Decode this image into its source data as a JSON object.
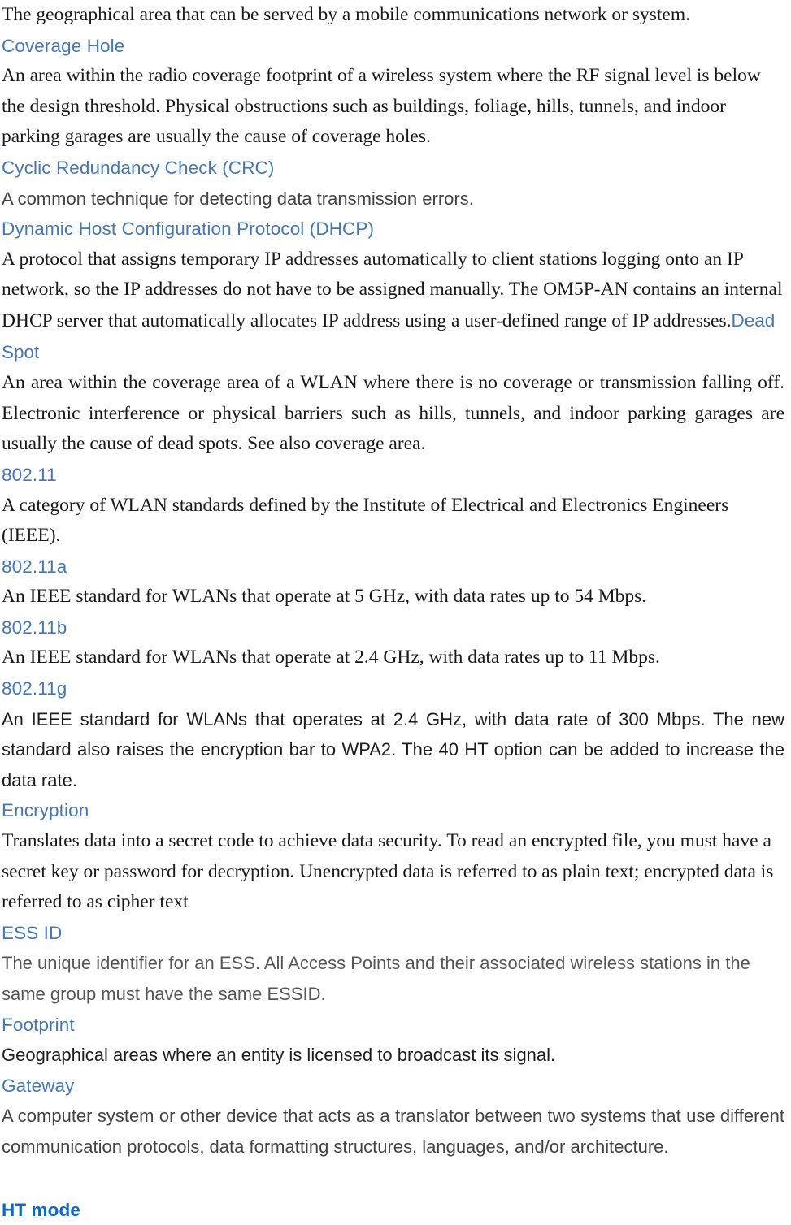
{
  "page": {
    "kind": "glossary-continuation",
    "colors": {
      "term_blue": "#4477b5",
      "term_blue_strong": "#1168c4",
      "body_serif": "#191919",
      "body_sans": "#434343",
      "body_sans_light": "#565656",
      "background": "#ffffff"
    }
  },
  "entries": [
    {
      "id": "coverage-area-continued",
      "term": null,
      "body": "The geographical area that can be served by a mobile communications network or system.",
      "body_style": "serif"
    },
    {
      "id": "coverage-hole",
      "term": "Coverage Hole",
      "body": "An area within the radio coverage footprint of a wireless system where the RF signal level is below the design threshold. Physical obstructions such as buildings, foliage, hills, tunnels, and indoor parking garages are usually the cause of coverage holes.",
      "body_style": "serif"
    },
    {
      "id": "cyclic-redundancy-check",
      "term": "Cyclic Redundancy  Check (CRC)",
      "body": "A common  technique for detecting data transmission errors.",
      "body_style": "sans"
    },
    {
      "id": "dhcp",
      "term": "Dynamic Host Configuration Protocol (DHCP)",
      "body": "A protocol that assigns temporary IP addresses automatically to client stations logging onto an IP network, so the IP addresses do not have to be assigned manually. The OM5P-AN contains an internal DHCP server that automatically allocates IP address using a user-defined range of IP addresses.",
      "body_style": "serif",
      "trailing_term": "Dead Spot"
    },
    {
      "id": "dead-spot",
      "term": null,
      "body": "An area within the coverage area of a WLAN where there is no coverage or transmission falling off. Electronic interference or physical barriers such as hills, tunnels, and indoor parking garages are usually the cause of dead spots. See also coverage area.",
      "body_style": "serif-justified"
    },
    {
      "id": "802-11",
      "term": "802.11",
      "body": "A category of WLAN standards defined by the Institute of Electrical and Electronics Engineers (IEEE).",
      "body_style": "serif"
    },
    {
      "id": "802-11a",
      "term": "802.11a",
      "body": "An IEEE standard for WLANs that operate at 5 GHz, with data rates up to 54 Mbps.",
      "body_style": "serif"
    },
    {
      "id": "802-11b",
      "term": "802.11b",
      "body": "An IEEE standard for WLANs that operate at 2.4 GHz, with data rates up to 11 Mbps.",
      "body_style": "serif"
    },
    {
      "id": "802-11g",
      "term": "802.11g",
      "body": "An  IEEE standard for WLANs that operates at 2.4  GHz, with data rate of 300 Mbps.  The new standard also raises the encryption  bar to WPA2. The 40 HT option can be added to increase the data rate.",
      "body_style": "sans-dark-justified"
    },
    {
      "id": "encryption",
      "term": "Encryption",
      "body": "Translates data into a secret code to achieve data security. To read an encrypted file, you must have a secret key or password for decryption. Unencrypted data is referred to as plain text; encrypted data is referred to as cipher text",
      "body_style": "serif"
    },
    {
      "id": "ess-id",
      "term": "ESS ID",
      "body": "The unique identifier for an ESS. All  Access Points and their associated wireless stations in the same group must have the same ESSID.",
      "body_style": "sans-light"
    },
    {
      "id": "footprint",
      "term": "Footprint",
      "body": "Geographical areas where  an entity is licensed  to broadcast its signal.",
      "body_style": "sans-dark"
    },
    {
      "id": "gateway",
      "term": "Gateway",
      "body": "A computer system or other device that acts as a translator between two systems that use different communication protocols, data formatting structures, languages, and/or architecture.",
      "body_style": "sans-justified"
    },
    {
      "id": "ht-mode",
      "term": "HT mode",
      "term_emphasis": "bold",
      "body": null,
      "body_style": null
    }
  ]
}
